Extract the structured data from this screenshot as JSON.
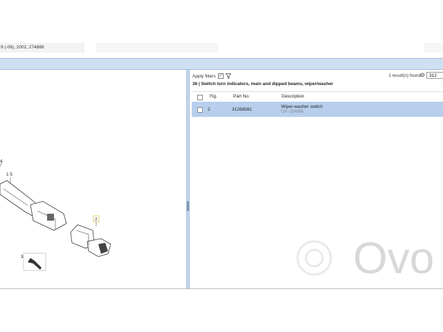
{
  "vehicle": "9 (-06), 2002, 274888",
  "filters": {
    "label": "Apply filters",
    "checkbox_mark": "✓"
  },
  "results": {
    "text": "1 result(s) found.",
    "search_value": "312"
  },
  "section_title": "36  |  Switch turn indicators, main and dipped beams, wiper/washer",
  "table": {
    "headers": {
      "fig": "Fig.",
      "part_no": "Part No.",
      "description": "Description"
    },
    "rows": [
      {
        "fig": "2",
        "part_no": "31268581",
        "description": "Wiper-washer switch",
        "sub": "CH -334998"
      }
    ]
  },
  "diagram": {
    "callouts": {
      "c4": "4",
      "c15": "1 5",
      "c2": "2",
      "c3": "3"
    }
  },
  "watermark": "Ovo"
}
